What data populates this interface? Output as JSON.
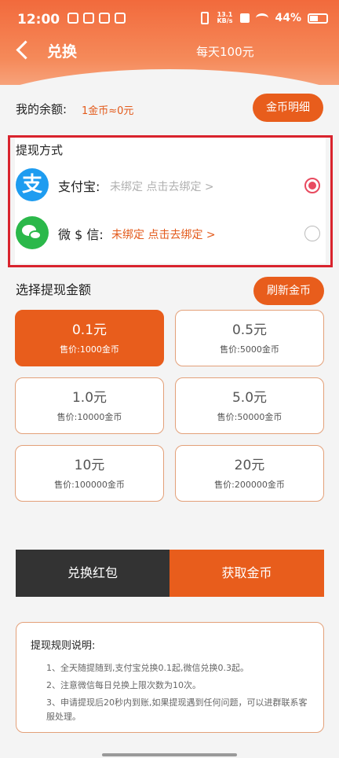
{
  "status_bar": {
    "time": "12:00",
    "net_speed": "13.1 KB/s",
    "battery": "44%"
  },
  "header": {
    "title": "兑换",
    "daily_limit": "每天100元"
  },
  "balance": {
    "label": "我的余额:",
    "value": "1金币≈0元",
    "detail_button": "金币明细"
  },
  "withdraw_method": {
    "title": "提现方式",
    "options": [
      {
        "name": "支付宝:",
        "icon": "alipay-icon",
        "icon_glyph": "支",
        "status": "未绑定 点击去绑定 >",
        "status_color": "#b0b0b0",
        "selected": true
      },
      {
        "name": "微 $ 信:",
        "icon": "wechat-icon",
        "status": "未绑定 点击去绑定 >",
        "status_color": "#e35a1b",
        "selected": false
      }
    ]
  },
  "amount": {
    "title": "选择提现金额",
    "refresh_button": "刷新金币",
    "options": [
      {
        "amount": "0.1元",
        "price": "售价:1000金币",
        "selected": true
      },
      {
        "amount": "0.5元",
        "price": "售价:5000金币",
        "selected": false
      },
      {
        "amount": "1.0元",
        "price": "售价:10000金币",
        "selected": false
      },
      {
        "amount": "5.0元",
        "price": "售价:50000金币",
        "selected": false
      },
      {
        "amount": "10元",
        "price": "售价:100000金币",
        "selected": false
      },
      {
        "amount": "20元",
        "price": "售价:200000金币",
        "selected": false
      }
    ]
  },
  "actions": {
    "exchange_label": "兑换红包",
    "earn_label": "获取金币"
  },
  "rules": {
    "title": "提现规则说明:",
    "items": [
      "1、全天随提随到,支付宝兑换0.1起,微信兑换0.3起。",
      "2、注意微信每日兑换上限次数为10次。",
      "3、申请提现后20秒内到账,如果提现遇到任何问题，可以进群联系客服处理。"
    ]
  },
  "colors": {
    "accent": "#e85d1c",
    "highlight_border": "#d9232d",
    "dark_button": "#333333"
  }
}
